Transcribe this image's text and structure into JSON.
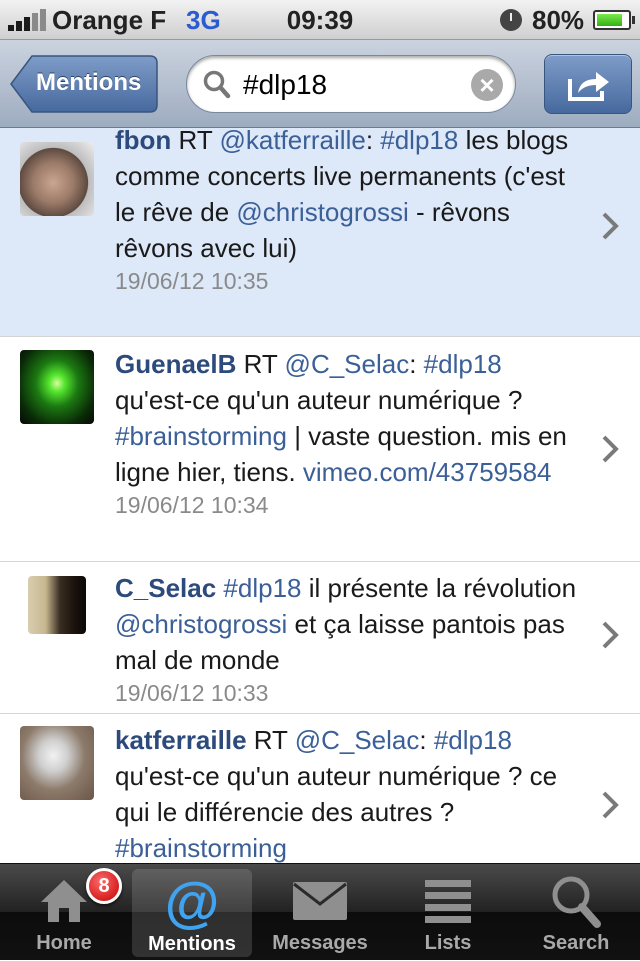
{
  "status_bar": {
    "carrier": "Orange F",
    "network": "3G",
    "time": "09:39",
    "battery": "80%",
    "battery_level": 0.8
  },
  "nav": {
    "back_label": "Mentions",
    "search_value": "#dlp18"
  },
  "tweets": [
    {
      "user": "fbon",
      "segments": [
        {
          "t": " RT ",
          "k": "text"
        },
        {
          "t": "@katferraille",
          "k": "link"
        },
        {
          "t": ": ",
          "k": "text"
        },
        {
          "t": "#dlp18",
          "k": "link"
        },
        {
          "t": " les blogs comme concerts live permanents (c'est le rêve de ",
          "k": "text"
        },
        {
          "t": "@christogrossi",
          "k": "link"
        },
        {
          "t": " - rêvons rêvons avec lui)",
          "k": "text"
        }
      ],
      "time": "19/06/12 10:35",
      "highlighted": true
    },
    {
      "user": "GuenaelB",
      "segments": [
        {
          "t": " RT ",
          "k": "text"
        },
        {
          "t": "@C_Selac",
          "k": "link"
        },
        {
          "t": ": ",
          "k": "text"
        },
        {
          "t": "#dlp18",
          "k": "link"
        },
        {
          "t": " qu'est-ce qu'un auteur numérique ? ",
          "k": "text"
        },
        {
          "t": "#brainstorming",
          "k": "link"
        },
        {
          "t": " | vaste question. mis en ligne hier, tiens. ",
          "k": "text"
        },
        {
          "t": "vimeo.com/43759584",
          "k": "link"
        }
      ],
      "time": "19/06/12 10:34",
      "highlighted": false
    },
    {
      "user": "C_Selac",
      "segments": [
        {
          "t": " ",
          "k": "text"
        },
        {
          "t": "#dlp18",
          "k": "link"
        },
        {
          "t": " il présente la révolution ",
          "k": "text"
        },
        {
          "t": "@christogrossi",
          "k": "link"
        },
        {
          "t": " et ça laisse pantois pas mal de monde",
          "k": "text"
        }
      ],
      "time": "19/06/12 10:33",
      "highlighted": false
    },
    {
      "user": "katferraille",
      "segments": [
        {
          "t": " RT ",
          "k": "text"
        },
        {
          "t": "@C_Selac",
          "k": "link"
        },
        {
          "t": ": ",
          "k": "text"
        },
        {
          "t": "#dlp18",
          "k": "link"
        },
        {
          "t": " qu'est-ce qu'un auteur numérique ? ce qui le différencie des autres ? ",
          "k": "text"
        },
        {
          "t": "#brainstorming",
          "k": "link"
        }
      ],
      "time": "",
      "highlighted": false
    }
  ],
  "tabs": [
    {
      "label": "Home",
      "icon": "home-icon",
      "badge": "8"
    },
    {
      "label": "Mentions",
      "icon": "at-icon",
      "active": true
    },
    {
      "label": "Messages",
      "icon": "envelope-icon"
    },
    {
      "label": "Lists",
      "icon": "list-icon"
    },
    {
      "label": "Search",
      "icon": "search-icon"
    }
  ],
  "colors": {
    "link": "#3b5f97",
    "username": "#2c4a7b",
    "highlight_row": "#dde8f8",
    "active_tab": "#3fa3f0"
  }
}
